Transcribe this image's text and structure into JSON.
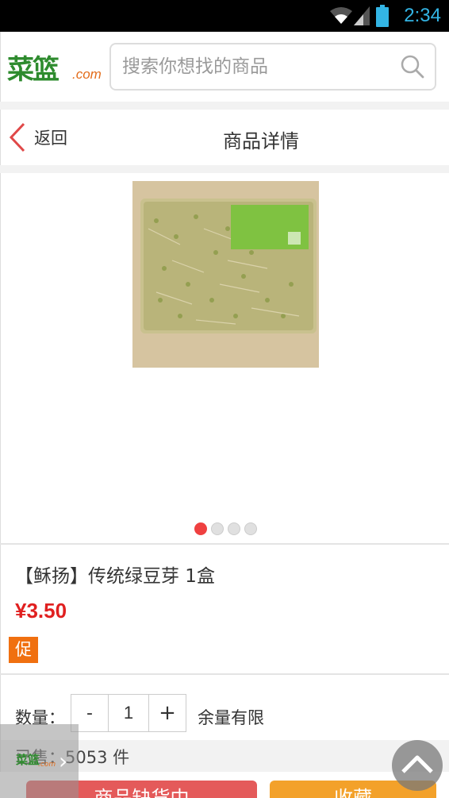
{
  "status_bar": {
    "time": "2:34"
  },
  "header": {
    "logo_text": "菜篮",
    "logo_domain": ".com",
    "search_placeholder": "搜索你想找的商品"
  },
  "nav": {
    "back_label": "返回",
    "title": "商品详情"
  },
  "gallery": {
    "total_images": 4,
    "active_index": 0
  },
  "product": {
    "name": "【稣扬】传统绿豆芽 1盒",
    "price": "¥3.50",
    "promo_badge": "促"
  },
  "quantity": {
    "label": "数量：",
    "minus": "-",
    "value": "1",
    "plus": "+",
    "stock_text": "余量有限"
  },
  "sales": {
    "text": "已售：5053 件"
  },
  "float_logo": {
    "logo_text": "菜篮",
    "logo_domain": ".com"
  },
  "actions": {
    "out_of_stock_label": "商品缺货中",
    "favorite_label": "收藏"
  },
  "colors": {
    "accent_red": "#e02020",
    "promo_orange": "#f07010",
    "brand_green": "#2e8b2e"
  }
}
